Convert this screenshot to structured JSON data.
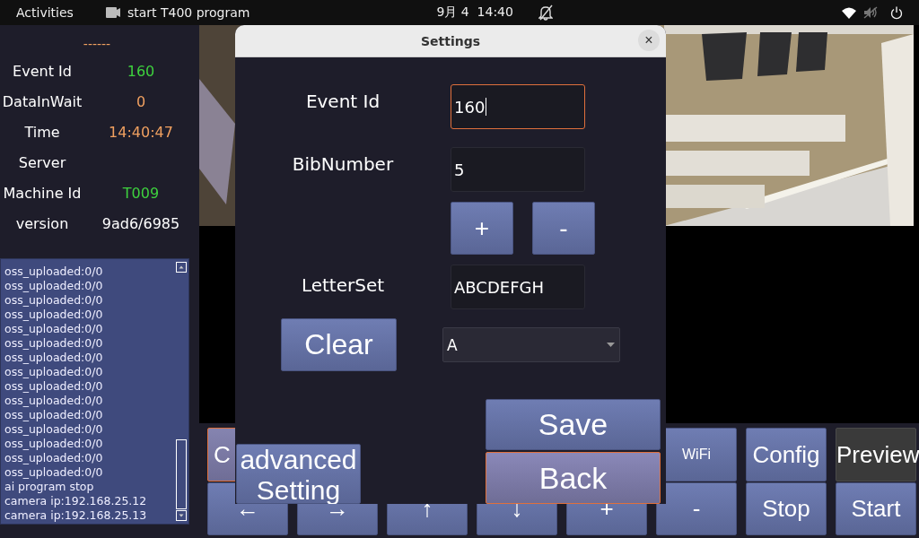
{
  "top_bar": {
    "activities": "Activities",
    "app_name": "start T400 program",
    "clock": "9月 4  14:40"
  },
  "status": {
    "header": "------",
    "rows": [
      {
        "label": "Event Id",
        "value": "160",
        "color": "#3ed13e"
      },
      {
        "label": "DataInWait",
        "value": "0",
        "color": "#f0a060"
      },
      {
        "label": "Time",
        "value": "14:40:47",
        "color": "#f0a060"
      },
      {
        "label": "Server"
      },
      {
        "label": "Machine Id",
        "value": "T009",
        "color": "#3ed13e"
      },
      {
        "label": "version",
        "value": "9ad6/6985",
        "color": "#ffffff"
      }
    ]
  },
  "log": {
    "lines": [
      "oss_uploaded:0/0",
      "oss_uploaded:0/0",
      "oss_uploaded:0/0",
      "oss_uploaded:0/0",
      "oss_uploaded:0/0",
      "oss_uploaded:0/0",
      "oss_uploaded:0/0",
      "oss_uploaded:0/0",
      "oss_uploaded:0/0",
      "oss_uploaded:0/0",
      "oss_uploaded:0/0",
      "oss_uploaded:0/0",
      "oss_uploaded:0/0",
      "oss_uploaded:0/0",
      "oss_uploaded:0/0",
      "ai program stop",
      "camera ip:192.168.25.12",
      "camera ip:192.168.25.13"
    ]
  },
  "buttons_top": [
    {
      "label": "C",
      "focused": true,
      "active": false
    },
    {
      "label": "WiFi",
      "focused": false,
      "active": false
    },
    {
      "label": "Config",
      "focused": false,
      "active": false
    },
    {
      "label": "Preview",
      "focused": false,
      "active": true
    }
  ],
  "buttons_bottom": [
    "←",
    "→",
    "↑",
    "↓",
    "+",
    "-",
    "Stop",
    "Start"
  ],
  "dialog": {
    "title": "Settings",
    "close": "×",
    "fields": [
      {
        "label": "Event Id",
        "value": "160",
        "focused": true
      },
      {
        "label": "BibNumber",
        "value": "5",
        "focused": false
      }
    ],
    "step_buttons": [
      "+",
      "-"
    ],
    "letter_set": {
      "label": "LetterSet",
      "value": "ABCDEFGH"
    },
    "clear": "Clear",
    "dropdown": "A",
    "advanced": "advanced Setting",
    "save": "Save",
    "back": {
      "label": "Back",
      "focused": true
    }
  }
}
